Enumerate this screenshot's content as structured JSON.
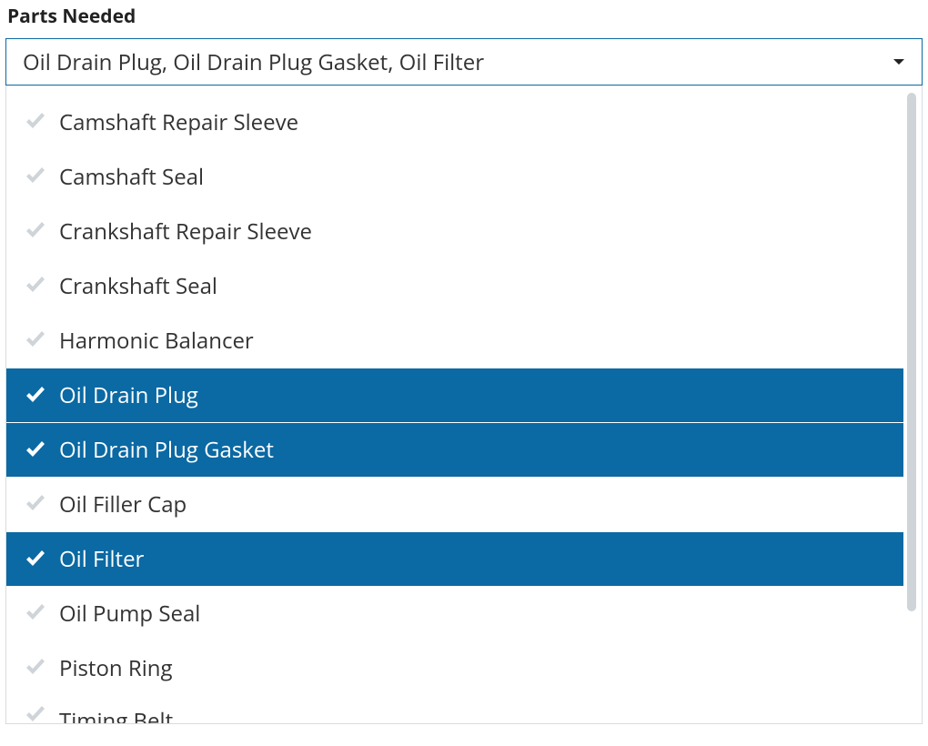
{
  "label": "Parts Needed",
  "selected_display": "Oil Drain Plug, Oil Drain Plug Gasket, Oil Filter",
  "options": [
    {
      "label": "Camshaft Repair Sleeve",
      "selected": false
    },
    {
      "label": "Camshaft Seal",
      "selected": false
    },
    {
      "label": "Crankshaft Repair Sleeve",
      "selected": false
    },
    {
      "label": "Crankshaft Seal",
      "selected": false
    },
    {
      "label": "Harmonic Balancer",
      "selected": false
    },
    {
      "label": "Oil Drain Plug",
      "selected": true
    },
    {
      "label": "Oil Drain Plug Gasket",
      "selected": true
    },
    {
      "label": "Oil Filler Cap",
      "selected": false
    },
    {
      "label": "Oil Filter",
      "selected": true
    },
    {
      "label": "Oil Pump Seal",
      "selected": false
    },
    {
      "label": "Piston Ring",
      "selected": false
    },
    {
      "label": "Timing Belt",
      "selected": false
    }
  ]
}
